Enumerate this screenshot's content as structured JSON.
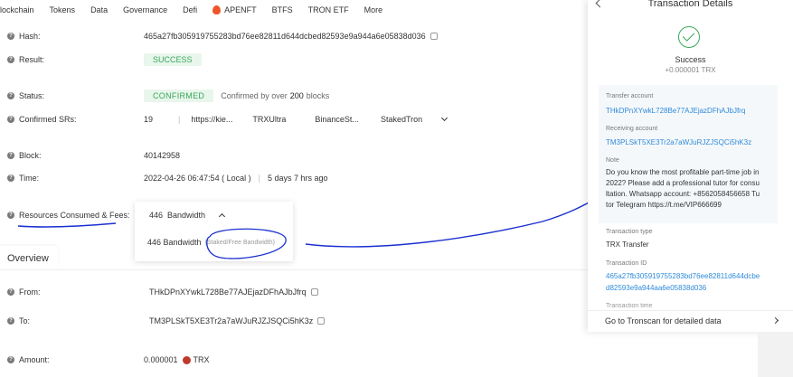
{
  "nav": {
    "items": [
      "lockchain",
      "Tokens",
      "Data",
      "Governance",
      "Defi",
      "APENFT",
      "BTFS",
      "TRON ETF",
      "More"
    ]
  },
  "details": {
    "hash": {
      "label": "Hash:",
      "value": "465a27fb305919755283bd76ee82811d644dcbed82593e9a944a6e05838d036"
    },
    "result": {
      "label": "Result:",
      "value": "SUCCESS"
    },
    "status": {
      "label": "Status:",
      "value": "CONFIRMED",
      "note_prefix": "Confirmed by over",
      "note_count": "200",
      "note_suffix": "blocks"
    },
    "confirmed_srs": {
      "label": "Confirmed SRs:",
      "count": "19",
      "srs": [
        "https://kie...",
        "TRXUltra",
        "BinanceSt...",
        "StakedTron"
      ]
    },
    "block": {
      "label": "Block:",
      "value": "40142958"
    },
    "time": {
      "label": "Time:",
      "value": "2022-04-26 06:47:54 ( Local )",
      "sep": "|",
      "ago": "5 days 7 hrs ago"
    },
    "resources": {
      "label": "Resources Consumed & Fees:",
      "amount": "446",
      "unit": "Bandwidth",
      "detail": "446 Bandwidth",
      "detail_tag": "(Staked/Free Bandwidth)"
    }
  },
  "overview": {
    "tab_label": "Overview",
    "from": {
      "label": "From:",
      "value": "THkDPnXYwkL728Be77AJEjazDFhAJbJfrq"
    },
    "to": {
      "label": "To:",
      "value": "TM3PLSkT5XE3Tr2a7aWJuRJZJSQCi5hK3z"
    },
    "amount": {
      "label": "Amount:",
      "value": "0.000001",
      "token": "TRX"
    }
  },
  "panel": {
    "title": "Transaction Details",
    "status": "Success",
    "amount": "+0.000001 TRX",
    "transfer_account_label": "Transfer account",
    "transfer_account": "THkDPnXYwkL728Be77AJEjazDFhAJbJfrq",
    "receiving_account_label": "Receiving account",
    "receiving_account": "TM3PLSkT5XE3Tr2a7aWJuRJZJSQCi5hK3z",
    "note_label": "Note",
    "note_lines": [
      "Do you know the most profitable part-time job in",
      "2022? Please add a professional tutor for consu",
      "ltation. Whatsapp account: +8562058456658 Tu",
      "tor Telegram https://t.me/VIP666699"
    ],
    "tx_type_label": "Transaction type",
    "tx_type": "TRX Transfer",
    "tx_id_label": "Transaction ID",
    "tx_id_lines": [
      "465a27fb305919755283bd76ee82811d644dcbe",
      "d82593e9a944aa6e05838d036"
    ],
    "tx_time_label": "Transaction time",
    "footer_link": "Go to Tronscan for detailed data"
  },
  "colors": {
    "success_green": "#3aa85a",
    "link_blue": "#2f8bda",
    "annotation_blue": "#1a2fd0"
  }
}
